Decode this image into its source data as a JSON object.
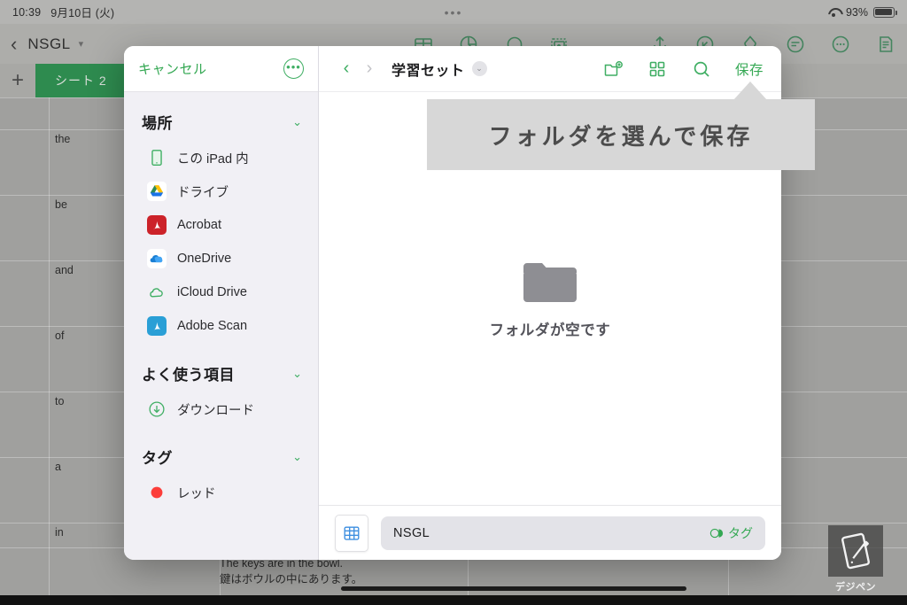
{
  "statusbar": {
    "time": "10:39",
    "date": "9月10日 (火)",
    "center_dots": "•••",
    "battery_percent": "93%",
    "wifi_icon": "wifi-icon",
    "battery_icon": "battery-icon"
  },
  "app_toolbar": {
    "back_icon": "back-chevron-icon",
    "title": "NSGL",
    "title_caret": "▾",
    "left_icons": [
      "table-icon",
      "chart-icon",
      "shape-icon",
      "image-icon"
    ],
    "right_icons": [
      "share-icon",
      "undo-icon",
      "paint-format-icon",
      "text-format-icon",
      "more-icon",
      "document-icon"
    ]
  },
  "sheet_bar": {
    "add_label": "+",
    "tab_label": "シート 2"
  },
  "spreadsheet": {
    "cells": [
      "the",
      "be",
      "and",
      "of",
      "to",
      "a",
      "in"
    ],
    "bottom_rows": [
      "The keys are in the bowl.",
      "鍵はボウルの中にあります。"
    ]
  },
  "watermark": {
    "label": "デジペン",
    "icon": "tablet-pencil-icon"
  },
  "dialog": {
    "sidebar": {
      "cancel_label": "キャンセル",
      "more_icon": "more-circle-icon",
      "sections": [
        {
          "title": "場所",
          "caret": "⌄",
          "items": [
            {
              "label": "この iPad 内",
              "icon": "ipad-icon",
              "color": "#3fae63"
            },
            {
              "label": "ドライブ",
              "icon": "google-drive-icon",
              "color": "#4285f4"
            },
            {
              "label": "Acrobat",
              "icon": "acrobat-icon",
              "color": "#cc2229"
            },
            {
              "label": "OneDrive",
              "icon": "onedrive-icon",
              "color": "#0f6cbd"
            },
            {
              "label": "iCloud Drive",
              "icon": "icloud-icon",
              "color": "#3fae63"
            },
            {
              "label": "Adobe Scan",
              "icon": "adobe-scan-icon",
              "color": "#2a9fd6"
            }
          ]
        },
        {
          "title": "よく使う項目",
          "caret": "⌄",
          "items": [
            {
              "label": "ダウンロード",
              "icon": "download-icon",
              "color": "#3fae63"
            }
          ]
        },
        {
          "title": "タグ",
          "caret": "⌄",
          "items": [
            {
              "label": "レッド",
              "icon": "red-dot-icon",
              "color": "#fc3d39"
            }
          ]
        }
      ]
    },
    "main": {
      "back_chevron": "‹",
      "forward_chevron": "›",
      "title": "学習セット",
      "title_caret": "⌄",
      "actions": [
        "new-folder-icon",
        "grid-view-icon",
        "search-icon"
      ],
      "save_label": "保存",
      "empty_icon": "folder-icon",
      "empty_text": "フォルダが空です",
      "file_icon": "spreadsheet-icon",
      "filename_value": "NSGL",
      "tag_label": "タグ",
      "tag_icon": "tag-icon"
    }
  },
  "callout": {
    "text": "フォルダを選んで保存"
  },
  "colors": {
    "accent_green": "#34a853",
    "sheet_tab_green": "#2e8b4f",
    "callout_bg": "#d7d7d7"
  }
}
